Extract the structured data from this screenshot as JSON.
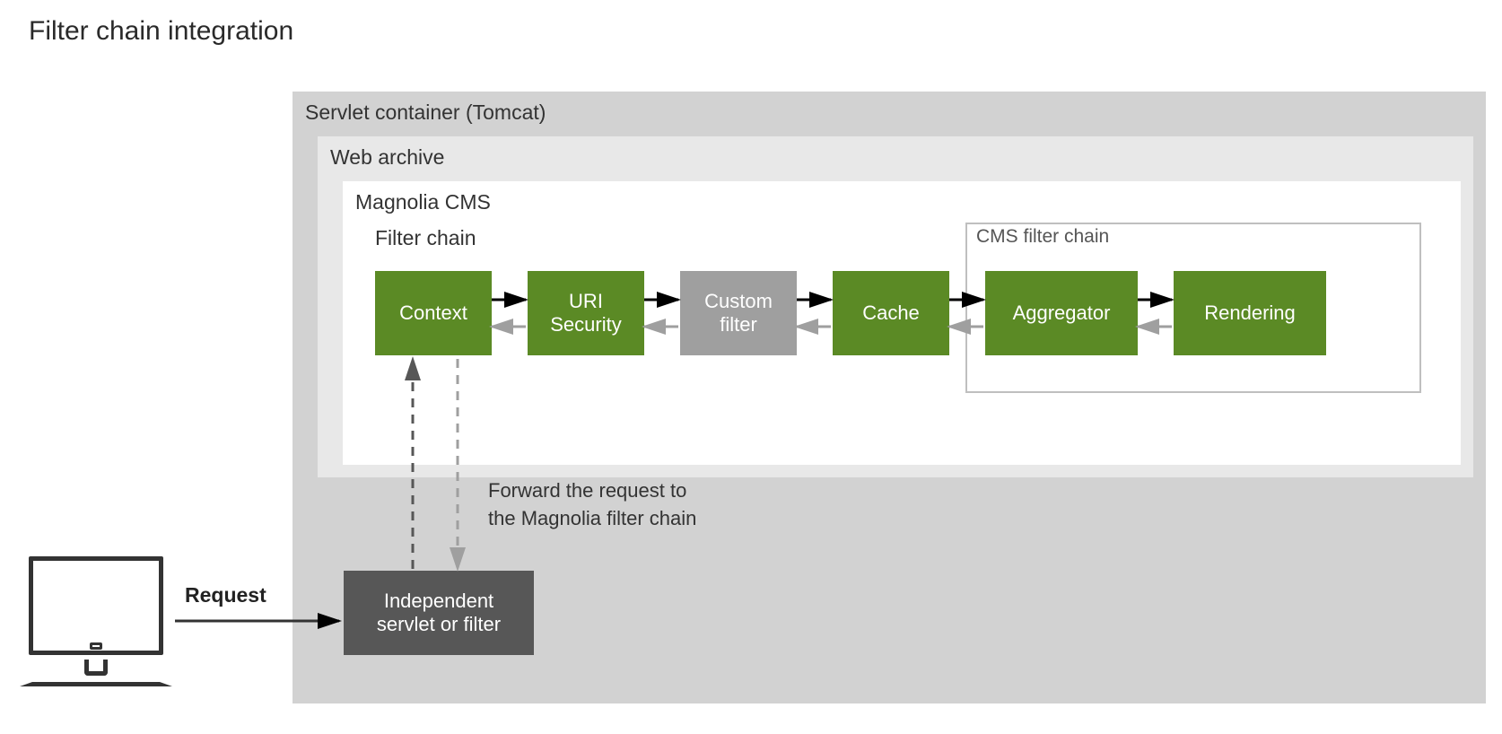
{
  "title": "Filter chain integration",
  "containers": {
    "servlet": "Servlet container (Tomcat)",
    "web_archive": "Web archive",
    "magnolia_cms": "Magnolia CMS",
    "filter_chain": "Filter chain",
    "cms_filter_chain": "CMS filter chain"
  },
  "filters": {
    "context": "Context",
    "uri_security": "URI\nSecurity",
    "custom": "Custom\nfilter",
    "cache": "Cache",
    "aggregator": "Aggregator",
    "rendering": "Rendering"
  },
  "independent": "Independent\nservlet or filter",
  "forward_text": "Forward the request to\nthe Magnolia filter chain",
  "request_label": "Request",
  "colors": {
    "green": "#5b8a25",
    "box_gray": "#9f9f9f",
    "dark_gray": "#575757",
    "panel_gray": "#d2d2d2",
    "panel_light": "#e8e8e8",
    "arrow_black": "#000000",
    "arrow_gray": "#9f9f9f"
  }
}
